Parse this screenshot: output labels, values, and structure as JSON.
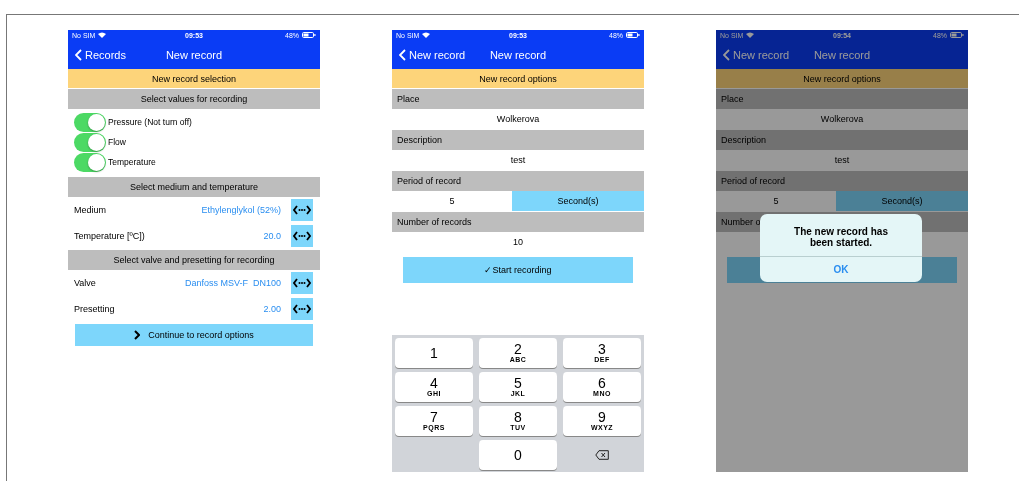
{
  "screens": [
    {
      "dimmed": false,
      "status": {
        "carrier": "No SIM",
        "time": "09:53",
        "battery": "48%"
      },
      "nav": {
        "back": "Records",
        "title": "New record"
      },
      "blocks": [
        {
          "kind": "banner",
          "text": "New record selection"
        },
        {
          "kind": "header",
          "text": "Select values for recording"
        },
        {
          "kind": "toggles",
          "items": [
            {
              "label": "Pressure (Not turn off)",
              "on": true
            },
            {
              "label": "Flow",
              "on": true
            },
            {
              "label": "Temperature",
              "on": true
            }
          ]
        },
        {
          "kind": "header",
          "text": "Select medium and temperature"
        },
        {
          "kind": "picker",
          "label": "Medium",
          "value": "Ethylenglykol (52%)"
        },
        {
          "kind": "picker",
          "label": "Temperature [ºC])",
          "value": "20.0"
        },
        {
          "kind": "header",
          "text": "Select valve and presetting for recording"
        },
        {
          "kind": "picker",
          "label": "Valve",
          "value": "Danfoss MSV-F  DN100"
        },
        {
          "kind": "picker",
          "label": "Presetting",
          "value": "2.00"
        },
        {
          "kind": "button",
          "label": "Continue to record options"
        }
      ]
    },
    {
      "dimmed": false,
      "status": {
        "carrier": "No SIM",
        "time": "09:53",
        "battery": "48%"
      },
      "nav": {
        "back": "New record",
        "title": "New record"
      },
      "blocks": [
        {
          "kind": "banner",
          "text": "New record options"
        },
        {
          "kind": "label",
          "text": "Place"
        },
        {
          "kind": "value",
          "text": "Wolkerova"
        },
        {
          "kind": "label",
          "text": "Description"
        },
        {
          "kind": "value",
          "text": "test"
        },
        {
          "kind": "label",
          "text": "Period of record"
        },
        {
          "kind": "split",
          "value": "5",
          "unit": "Second(s)"
        },
        {
          "kind": "label",
          "text": "Number of records"
        },
        {
          "kind": "value",
          "text": "10"
        },
        {
          "kind": "start",
          "label": "✓Start recording"
        },
        {
          "kind": "keyboard",
          "keys": [
            {
              "kind": "digit",
              "digit": "1"
            },
            {
              "kind": "digit",
              "digit": "2",
              "letters": "ABC"
            },
            {
              "kind": "digit",
              "digit": "3",
              "letters": "DEF"
            },
            {
              "kind": "digit",
              "digit": "4",
              "letters": "GHI"
            },
            {
              "kind": "digit",
              "digit": "5",
              "letters": "JKL"
            },
            {
              "kind": "digit",
              "digit": "6",
              "letters": "MNO"
            },
            {
              "kind": "digit",
              "digit": "7",
              "letters": "PQRS"
            },
            {
              "kind": "digit",
              "digit": "8",
              "letters": "TUV"
            },
            {
              "kind": "digit",
              "digit": "9",
              "letters": "WXYZ"
            },
            {
              "kind": "blank"
            },
            {
              "kind": "digit",
              "digit": "0"
            },
            {
              "kind": "delete"
            }
          ]
        }
      ]
    },
    {
      "dimmed": true,
      "status": {
        "carrier": "No SIM",
        "time": "09:54",
        "battery": "48%"
      },
      "nav": {
        "back": "New record",
        "title": "New record"
      },
      "blocks": [
        {
          "kind": "banner",
          "text": "New record options"
        },
        {
          "kind": "label",
          "text": "Place"
        },
        {
          "kind": "value",
          "text": "Wolkerova"
        },
        {
          "kind": "label",
          "text": "Description"
        },
        {
          "kind": "value",
          "text": "test"
        },
        {
          "kind": "label",
          "text": "Period of record"
        },
        {
          "kind": "split",
          "value": "5",
          "unit": "Second(s)"
        },
        {
          "kind": "label",
          "text": "Number o"
        },
        {
          "kind": "value"
        },
        {
          "kind": "start"
        }
      ],
      "alert": {
        "message": "The new record has been started.",
        "button": "OK"
      }
    }
  ]
}
